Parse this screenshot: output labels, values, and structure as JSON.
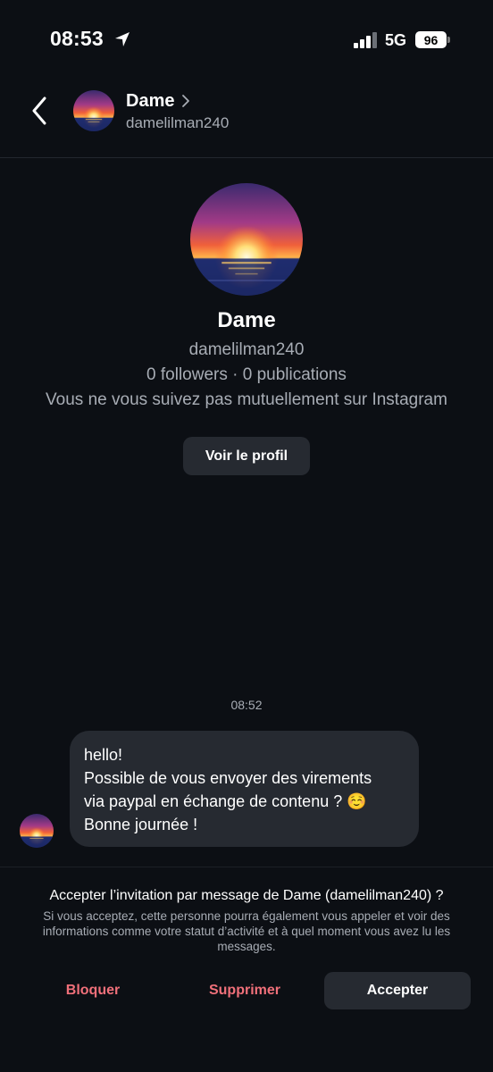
{
  "status_bar": {
    "time": "08:53",
    "network": "5G",
    "battery": "96"
  },
  "header": {
    "name": "Dame",
    "handle": "damelilman240"
  },
  "profile": {
    "name": "Dame",
    "handle": "damelilman240",
    "stats": "0 followers · 0 publications",
    "mutual": "Vous ne vous suivez pas mutuellement sur Instagram",
    "view_profile_label": "Voir le profil"
  },
  "conversation": {
    "timestamp": "08:52",
    "message_lines": [
      "hello!",
      "Possible de vous envoyer des virements",
      "via paypal en échange de contenu ? ☺️",
      "Bonne journée !"
    ]
  },
  "invitation": {
    "title": "Accepter l’invitation par message de Dame (damelilman240) ?",
    "description": "Si vous acceptez, cette personne pourra également vous appeler et voir des informations comme votre statut d’activité et à quel moment vous avez lu les messages.",
    "block_label": "Bloquer",
    "delete_label": "Supprimer",
    "accept_label": "Accepter"
  },
  "colors": {
    "background": "#0c0f14",
    "surface": "#262a31",
    "secondary_text": "#a8adb5",
    "destructive": "#f0707a"
  },
  "icons": {
    "back": "chevron-left-icon",
    "header_chevron": "chevron-right-icon",
    "location": "location-arrow-icon",
    "signal": "cellular-signal-icon"
  }
}
